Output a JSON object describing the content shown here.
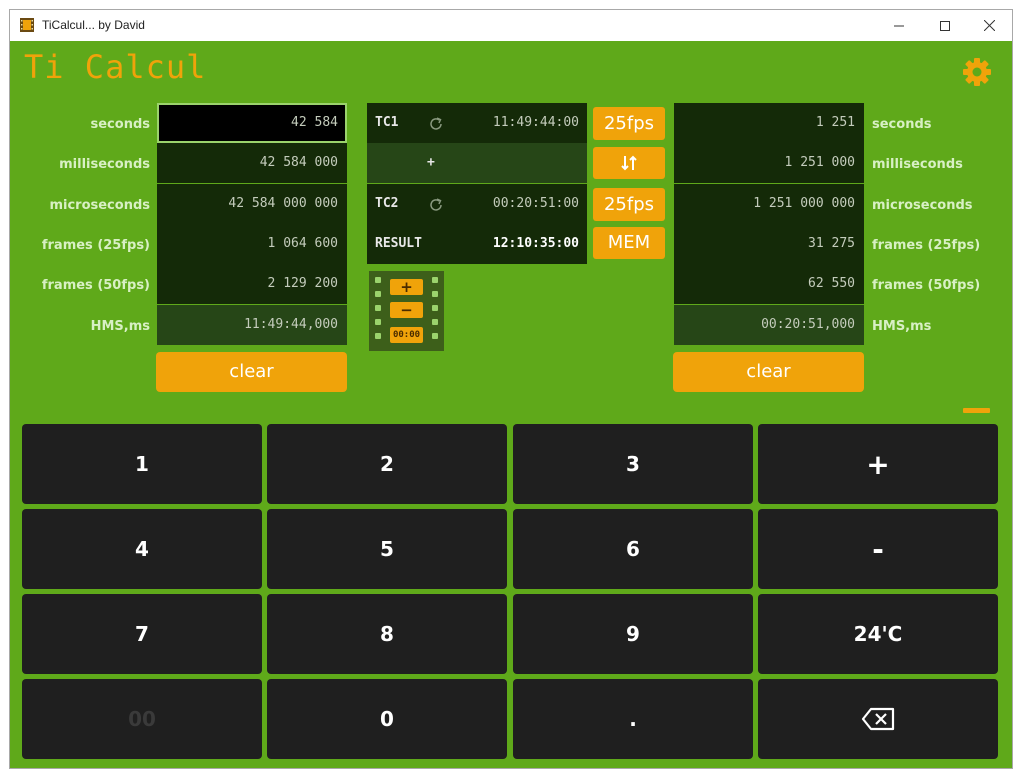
{
  "window": {
    "title": "TiCalcul... by David",
    "minimize": "—",
    "maximize": "☐",
    "close": "✕"
  },
  "app": {
    "title": "Ti Calcul"
  },
  "icons": {
    "settings": "gear-icon",
    "refresh": "refresh-icon",
    "swap": "swap-arrows-icon",
    "backspace": "backspace-icon",
    "film": "film-strip-icon"
  },
  "colors": {
    "background": "#5fa91a",
    "accent": "#f0a30a",
    "field": "#142a08",
    "key": "#1f1f1f"
  },
  "left": {
    "labels": {
      "seconds": "seconds",
      "milliseconds": "milliseconds",
      "microseconds": "microseconds",
      "frames25": "frames (25fps)",
      "frames50": "frames (50fps)",
      "hms": "HMS,ms"
    },
    "values": {
      "seconds": "42 584",
      "milliseconds": "42 584 000",
      "microseconds": "42 584 000 000",
      "frames25": "1 064 600",
      "frames50": "2 129 200",
      "hms": "11:49:44,000"
    },
    "clear_label": "clear"
  },
  "right": {
    "labels": {
      "seconds": "seconds",
      "milliseconds": "milliseconds",
      "microseconds": "microseconds",
      "frames25": "frames (25fps)",
      "frames50": "frames (50fps)",
      "hms": "HMS,ms"
    },
    "values": {
      "seconds": "1 251",
      "milliseconds": "1 251 000",
      "microseconds": "1 251 000 000",
      "frames25": "31 275",
      "frames50": "62 550",
      "hms": "00:20:51,000"
    },
    "clear_label": "clear"
  },
  "center": {
    "tc1": {
      "label": "TC1",
      "value": "11:49:44:00"
    },
    "operator": "+",
    "tc2": {
      "label": "TC2",
      "value": "00:20:51:00"
    },
    "result": {
      "label": "RESULT",
      "value": "12:10:35:00"
    },
    "fps1": "25fps",
    "fps2": "25fps",
    "mem": "MEM",
    "film": {
      "plus": "+",
      "minus": "−",
      "time": "00:00"
    }
  },
  "keypad": {
    "k1": "1",
    "k2": "2",
    "k3": "3",
    "plus": "+",
    "k4": "4",
    "k5": "5",
    "k6": "6",
    "minus": "-",
    "k7": "7",
    "k8": "8",
    "k9": "9",
    "tc": "24'C",
    "k00": "00",
    "k0": "0",
    "dot": "."
  }
}
